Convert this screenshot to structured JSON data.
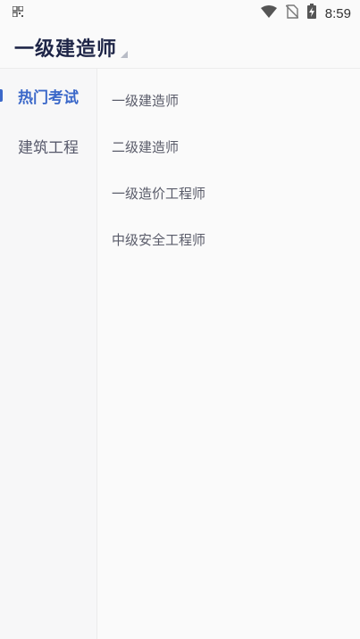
{
  "status_bar": {
    "time": "8:59",
    "icons": [
      "qr-icon",
      "wifi-icon",
      "no-sim-icon",
      "battery-charging-icon"
    ]
  },
  "header": {
    "title": "一级建造师"
  },
  "sidebar": {
    "items": [
      {
        "label": "热门考试",
        "active": true
      },
      {
        "label": "建筑工程",
        "active": false
      }
    ]
  },
  "exam_list": [
    {
      "label": "一级建造师"
    },
    {
      "label": "二级建造师"
    },
    {
      "label": "一级造价工程师"
    },
    {
      "label": "中级安全工程师"
    }
  ],
  "colors": {
    "accent": "#3b68c9",
    "title": "#1e2547",
    "text": "#5a5c6a",
    "background": "#fafafa"
  }
}
